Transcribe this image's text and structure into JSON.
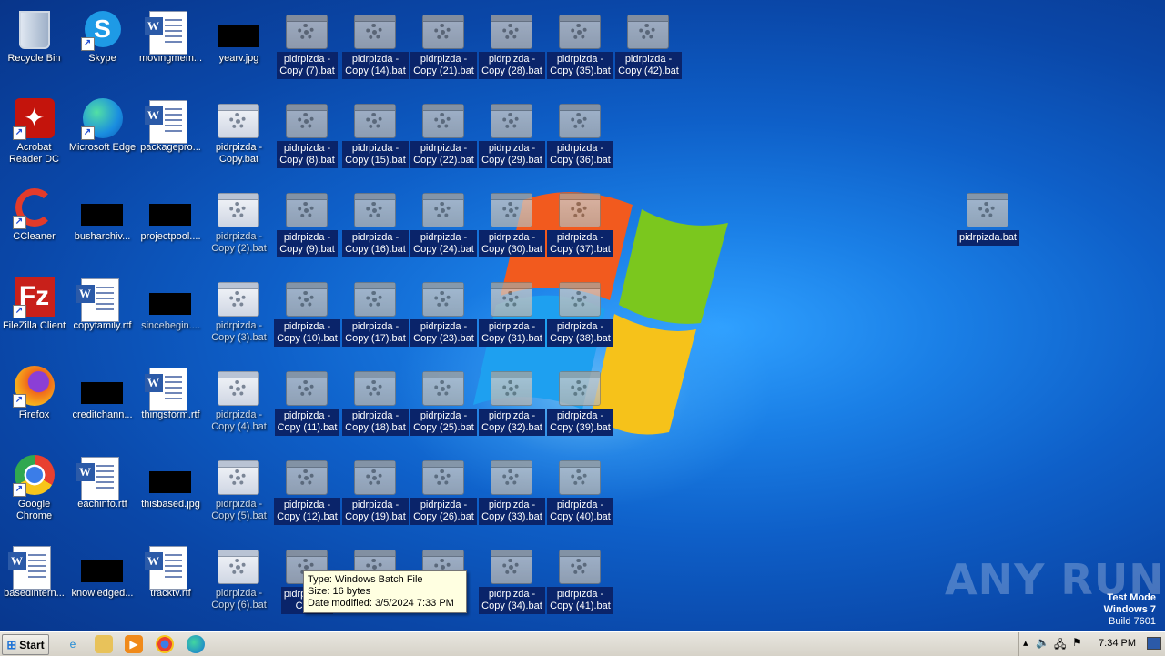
{
  "desktop": {
    "left_icons": [
      {
        "label": "Recycle Bin",
        "icon": "recycle-bin-icon"
      },
      {
        "label": "Skype",
        "icon": "skype-icon"
      },
      {
        "label": "movingmem...",
        "icon": "word-doc-icon"
      },
      {
        "label": "yearv.jpg",
        "icon": "image-thumbnail"
      },
      {
        "label": "Acrobat\nReader DC",
        "icon": "acrobat-icon"
      },
      {
        "label": "Microsoft Edge",
        "icon": "edge-icon"
      },
      {
        "label": "packagepro...",
        "icon": "word-doc-icon"
      },
      {
        "label": "pidrpizda -\nCopy.bat",
        "icon": "batch-file-icon"
      },
      {
        "label": "CCleaner",
        "icon": "ccleaner-icon"
      },
      {
        "label": "busharchiv...",
        "icon": "image-thumbnail"
      },
      {
        "label": "projectpool....",
        "icon": "image-thumbnail"
      },
      {
        "label": "pidrpizda -\nCopy (2).bat",
        "icon": "batch-file-icon"
      },
      {
        "label": "FileZilla Client",
        "icon": "filezilla-icon"
      },
      {
        "label": "copyfamily.rtf",
        "icon": "word-doc-icon"
      },
      {
        "label": "sincebegin....",
        "icon": "image-thumbnail"
      },
      {
        "label": "pidrpizda -\nCopy (3).bat",
        "icon": "batch-file-icon"
      },
      {
        "label": "Firefox",
        "icon": "firefox-icon"
      },
      {
        "label": "creditchann...",
        "icon": "image-thumbnail"
      },
      {
        "label": "thingsform.rtf",
        "icon": "word-doc-icon"
      },
      {
        "label": "pidrpizda -\nCopy (4).bat",
        "icon": "batch-file-icon"
      },
      {
        "label": "Google\nChrome",
        "icon": "chrome-icon"
      },
      {
        "label": "eachinfo.rtf",
        "icon": "word-doc-icon"
      },
      {
        "label": "thisbased.jpg",
        "icon": "image-thumbnail"
      },
      {
        "label": "pidrpizda -\nCopy (5).bat",
        "icon": "batch-file-icon"
      },
      {
        "label": "basedintern...",
        "icon": "word-doc-icon"
      },
      {
        "label": "knowledged...",
        "icon": "image-thumbnail"
      },
      {
        "label": "tracktv.rtf",
        "icon": "word-doc-icon"
      },
      {
        "label": "pidrpizda -\nCopy (6).bat",
        "icon": "batch-file-icon"
      }
    ],
    "selected_bat": [
      [
        "pidrpizda -\nCopy (7).bat",
        "pidrpizda -\nCopy (14).bat",
        "pidrpizda -\nCopy (21).bat",
        "pidrpizda -\nCopy (28).bat",
        "pidrpizda -\nCopy (35).bat",
        "pidrpizda -\nCopy (42).bat"
      ],
      [
        "pidrpizda -\nCopy (8).bat",
        "pidrpizda -\nCopy (15).bat",
        "pidrpizda -\nCopy (22).bat",
        "pidrpizda -\nCopy (29).bat",
        "pidrpizda -\nCopy (36).bat"
      ],
      [
        "pidrpizda -\nCopy (9).bat",
        "pidrpizda -\nCopy (16).bat",
        "pidrpizda -\nCopy (24).bat",
        "pidrpizda -\nCopy (30).bat",
        "pidrpizda -\nCopy (37).bat"
      ],
      [
        "pidrpizda -\nCopy (10).bat",
        "pidrpizda -\nCopy (17).bat",
        "pidrpizda -\nCopy (23).bat",
        "pidrpizda -\nCopy (31).bat",
        "pidrpizda -\nCopy (38).bat"
      ],
      [
        "pidrpizda -\nCopy (11).bat",
        "pidrpizda -\nCopy (18).bat",
        "pidrpizda -\nCopy (25).bat",
        "pidrpizda -\nCopy (32).bat",
        "pidrpizda -\nCopy (39).bat"
      ],
      [
        "pidrpizda -\nCopy (12).bat",
        "pidrpizda -\nCopy (19).bat",
        "pidrpizda -\nCopy (26).bat",
        "pidrpizda -\nCopy (33).bat",
        "pidrpizda -\nCopy (40).bat"
      ],
      [
        "pidrpizda -\nCopy",
        "pidrp",
        "pidrp",
        "pidrpizda -\nCopy (34).bat",
        "pidrpizda -\nCopy (41).bat"
      ]
    ],
    "lone_bat": "pidrpizda.bat"
  },
  "tooltip": {
    "type": "Type: Windows Batch File",
    "size": "Size: 16 bytes",
    "modified": "Date modified: 3/5/2024 7:33 PM"
  },
  "watermark": {
    "brand": "ANY RUN",
    "line1": "Test Mode",
    "line2": "Windows 7",
    "line3": "Build 7601"
  },
  "taskbar": {
    "start_label": "Start",
    "clock": "7:34 PM",
    "pinned": [
      "internet-explorer-icon",
      "file-explorer-icon",
      "media-player-icon",
      "chrome-icon",
      "edge-icon"
    ]
  }
}
